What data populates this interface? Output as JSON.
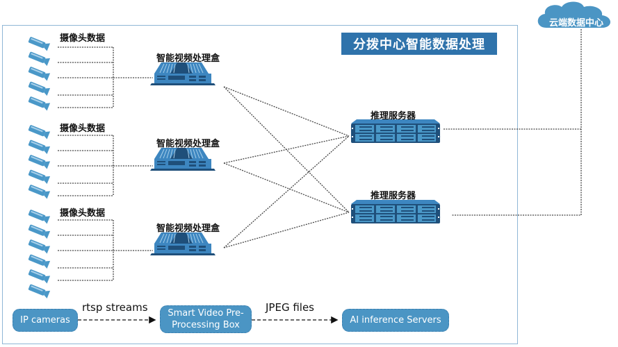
{
  "title": "分拨中心智能数据处理",
  "cloud": {
    "label": "云端数据中心"
  },
  "camera_groups": [
    {
      "label": "摄像头数据",
      "camera_count": 5,
      "line_count": 5
    },
    {
      "label": "摄像头数据",
      "camera_count": 5,
      "line_count": 5
    },
    {
      "label": "摄像头数据",
      "camera_count": 6,
      "line_count": 5
    }
  ],
  "boxes": [
    {
      "label": "智能视频处理盒"
    },
    {
      "label": "智能视频处理盒"
    },
    {
      "label": "智能视频处理盒"
    }
  ],
  "servers": [
    {
      "label": "推理服务器"
    },
    {
      "label": "推理服务器"
    }
  ],
  "legend_flow": {
    "nodes": [
      "IP cameras",
      "Smart Video Pre-Processing Box",
      "AI inference Servers"
    ],
    "node2_line1": "Smart Video Pre-",
    "node2_line2": "Processing Box",
    "edges": [
      "rtsp streams",
      "JPEG files"
    ]
  },
  "colors": {
    "accent": "#2f73ab",
    "device": "#3d86c0",
    "camera": "#4a98c8",
    "frame": "#8fb6d6",
    "cloud": "#4b95c4"
  }
}
